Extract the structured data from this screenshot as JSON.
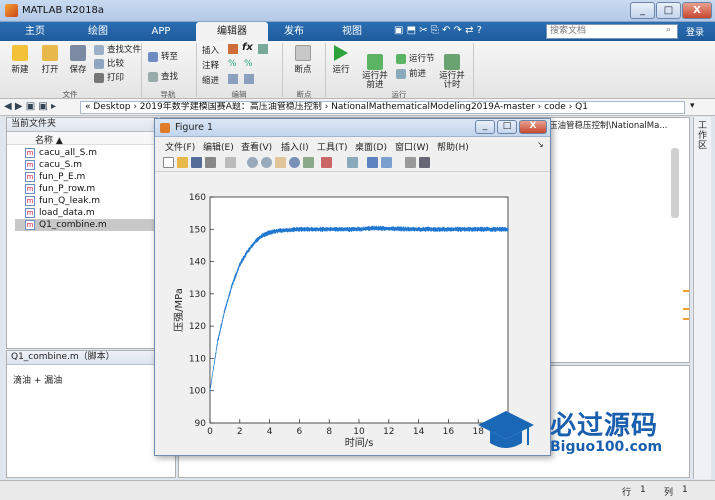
{
  "window": {
    "title": "MATLAB R2018a",
    "min_label": "_",
    "max_label": "□",
    "close_label": "X"
  },
  "tabs": [
    "主页",
    "绘图",
    "APP",
    "编辑器",
    "发布",
    "视图"
  ],
  "search": {
    "placeholder": "搜索文档",
    "login": "登录"
  },
  "ribbon": {
    "new": "新建",
    "open": "打开",
    "save": "保存",
    "find_files": "查找文件",
    "compare": "比较",
    "print": "打印",
    "goto": "转至",
    "find": "查找",
    "insert": "插入",
    "comment": "注释",
    "indent": "缩进",
    "fx": "fx",
    "breakpoint": "断点",
    "run": "运行",
    "run_advance": "运行并\n前进",
    "run_section": "运行节",
    "advance": "前进",
    "run_time": "运行并\n计时",
    "groups": {
      "file": "文件",
      "nav": "导航",
      "edit": "编辑",
      "breakpoint": "断点",
      "run": "运行"
    }
  },
  "address": {
    "path": "« Desktop › 2019年数学建模国赛A题：高压油管稳压控制 › NationalMathematicalModeling2019A-master › code › Q1"
  },
  "current_folder": {
    "header": "当前文件夹",
    "column": "名称 ▲",
    "files": [
      "cacu_all_S.m",
      "cacu_S.m",
      "fun_P_E.m",
      "fun_P_row.m",
      "fun_Q_leak.m",
      "load_data.m",
      "Q1_combine.m"
    ],
    "selected_index": 6
  },
  "details": {
    "header": "Q1_combine.m（脚本）",
    "text": "滴油 + 漏油"
  },
  "editor_tab": {
    "label": "压油管稳压控制\\NationalMa..."
  },
  "workspace": {
    "header": "工作区"
  },
  "statusbar": {
    "row_label": "行",
    "row_value": "1",
    "col_label": "列",
    "col_value": "1"
  },
  "figure": {
    "title": "Figure 1",
    "menu": [
      "文件(F)",
      "编辑(E)",
      "查看(V)",
      "插入(I)",
      "工具(T)",
      "桌面(D)",
      "窗口(W)",
      "帮助(H)"
    ]
  },
  "chart_data": {
    "type": "line",
    "xlabel": "时间/s",
    "ylabel": "压强/MPa",
    "xlim": [
      0,
      20
    ],
    "ylim": [
      90,
      160
    ],
    "xticks": [
      0,
      2,
      4,
      6,
      8,
      10,
      12,
      14,
      16,
      18
    ],
    "yticks": [
      90,
      100,
      110,
      120,
      130,
      140,
      150,
      160
    ],
    "grid": false,
    "series": [
      {
        "color": "#1f77d0",
        "x": [
          0,
          0.2,
          0.5,
          1,
          1.5,
          2,
          2.5,
          3,
          3.5,
          4,
          4.5,
          5,
          6,
          8,
          10,
          11,
          12,
          14,
          16,
          18,
          20
        ],
        "y": [
          100,
          106,
          115,
          125,
          133,
          139,
          143,
          146,
          148,
          149,
          149.5,
          149.7,
          150,
          150,
          150,
          150.4,
          150.2,
          150,
          150,
          150,
          150
        ],
        "noise_amplitude": 0.8
      }
    ]
  },
  "watermark": {
    "text": "必过源码",
    "url": "Biguo100.com"
  }
}
